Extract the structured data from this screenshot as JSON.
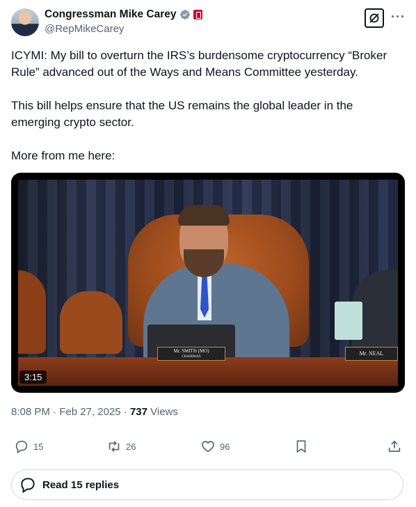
{
  "author": {
    "name": "Congressman Mike Carey",
    "handle": "@RepMikeCarey"
  },
  "tweet": {
    "paragraph1": "ICYMI: My bill to overturn the IRS’s burdensome cryptocurrency “Broker Rule” advanced out of the Ways and Means Committee yesterday.",
    "paragraph2": "This bill helps ensure that the US remains the global leader in the emerging crypto sector.",
    "paragraph3": "More from me here:"
  },
  "video": {
    "duration": "3:15",
    "nameplate_left": "Mr. SMITH (MO)",
    "nameplate_left_sub": "CHAIRMAN",
    "nameplate_right": "Mr. NEAL"
  },
  "meta": {
    "time": "8:08 PM · Feb 27, 2025 · ",
    "views_count": "737",
    "views_label": " Views"
  },
  "actions": {
    "replies": "15",
    "reposts": "26",
    "likes": "96"
  },
  "read_replies": "Read 15 replies",
  "icons": {
    "verified": "verified-badge-icon",
    "grok": "grok-icon",
    "more": "more-icon",
    "reply": "reply-icon",
    "repost": "repost-icon",
    "like": "heart-icon",
    "bookmark": "bookmark-icon",
    "share": "share-icon"
  },
  "colors": {
    "secondary_text": "#536471",
    "verified": "#829aab",
    "flag_red": "#c8102e"
  }
}
